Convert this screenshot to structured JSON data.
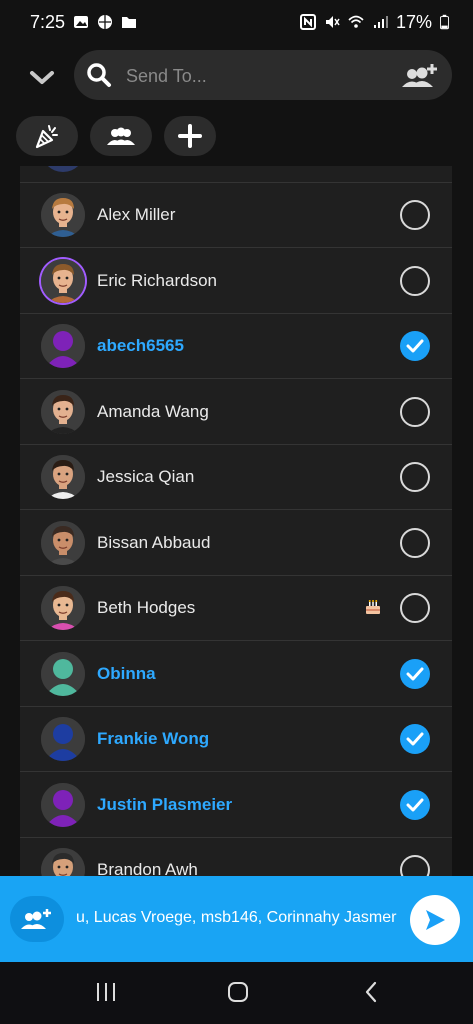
{
  "status": {
    "time": "7:25",
    "battery": "17%"
  },
  "search": {
    "placeholder": "Send To..."
  },
  "contacts": [
    {
      "name": "Alex Miller",
      "selected": false,
      "avatar": "bitmoji-man-blond"
    },
    {
      "name": "Eric Richardson",
      "selected": false,
      "avatar": "bitmoji-man-ring"
    },
    {
      "name": "abech6565",
      "selected": true,
      "avatar": "silhouette-purple"
    },
    {
      "name": "Amanda Wang",
      "selected": false,
      "avatar": "bitmoji-woman-dark-hair"
    },
    {
      "name": "Jessica Qian",
      "selected": false,
      "avatar": "bitmoji-woman-glasses"
    },
    {
      "name": "Bissan Abbaud",
      "selected": false,
      "avatar": "bitmoji-man-beard"
    },
    {
      "name": "Beth Hodges",
      "selected": false,
      "avatar": "bitmoji-woman-party",
      "badge": "birthday-cake-icon"
    },
    {
      "name": "Obinna",
      "selected": true,
      "avatar": "silhouette-teal"
    },
    {
      "name": "Frankie Wong",
      "selected": true,
      "avatar": "silhouette-blue"
    },
    {
      "name": "Justin Plasmeier",
      "selected": true,
      "avatar": "silhouette-purple"
    },
    {
      "name": "Brandon Awh",
      "selected": false,
      "avatar": "bitmoji-man-dark-hair"
    }
  ],
  "send_bar": {
    "recipients_text": "u, Lucas Vroege, msb146, Corinnahy Jasmer"
  },
  "colors": {
    "accent": "#1aa0f7",
    "selected_text": "#2ea9ff",
    "background": "#121212",
    "row_bg": "#1f1f1f"
  }
}
